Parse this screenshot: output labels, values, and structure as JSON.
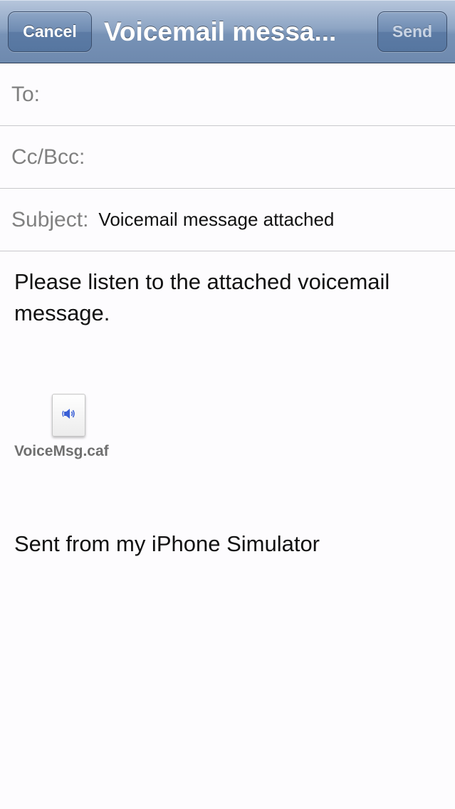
{
  "navbar": {
    "cancel_label": "Cancel",
    "title": "Voicemail messa...",
    "send_label": "Send"
  },
  "fields": {
    "to_label": "To:",
    "to_value": "",
    "cc_label": "Cc/Bcc:",
    "cc_value": "",
    "subject_label": "Subject:",
    "subject_value": "Voicemail message attached"
  },
  "body": {
    "message": "Please listen to the attached voicemail message.",
    "attachment": {
      "filename": "VoiceMsg.caf",
      "icon": "speaker-icon"
    },
    "signature": "Sent from my iPhone Simulator"
  },
  "colors": {
    "navbar": "#7792b6",
    "attachment_icon": "#3a5fd6"
  }
}
